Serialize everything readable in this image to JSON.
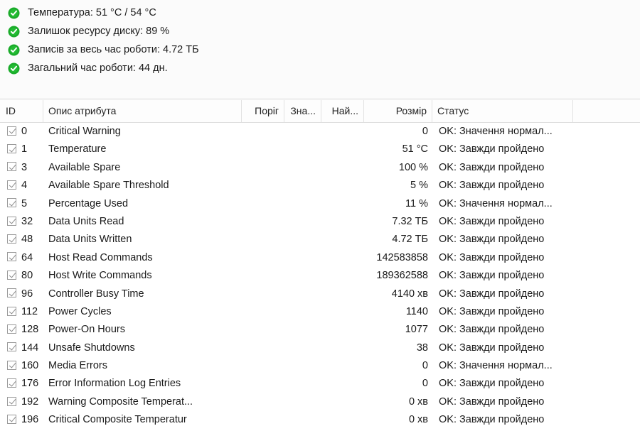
{
  "summary": {
    "icon": "green-check-circle-icon",
    "icon_color": "#1aab2a",
    "items": [
      {
        "label": "Температура: 51 °C / 54 °C"
      },
      {
        "label": "Залишок ресурсу диску: 89 %"
      },
      {
        "label": "Записів за весь час роботи: 4.72 ТБ"
      },
      {
        "label": "Загальний час роботи: 44 дн."
      }
    ]
  },
  "table": {
    "columns": [
      {
        "key": "id",
        "label": "ID"
      },
      {
        "key": "desc",
        "label": "Опис атрибута"
      },
      {
        "key": "threshold",
        "label": "Поріг"
      },
      {
        "key": "value",
        "label": "Зна..."
      },
      {
        "key": "worst",
        "label": "Най..."
      },
      {
        "key": "size",
        "label": "Розмір"
      },
      {
        "key": "status",
        "label": "Статус"
      },
      {
        "key": "spare",
        "label": ""
      }
    ],
    "rows": [
      {
        "checked": true,
        "id": "0",
        "desc": "Critical Warning",
        "threshold": "",
        "value": "",
        "worst": "",
        "size": "0",
        "status": "OK: Значення нормал..."
      },
      {
        "checked": true,
        "id": "1",
        "desc": "Temperature",
        "threshold": "",
        "value": "",
        "worst": "",
        "size": "51 °C",
        "status": "OK: Завжди пройдено"
      },
      {
        "checked": true,
        "id": "3",
        "desc": "Available Spare",
        "threshold": "",
        "value": "",
        "worst": "",
        "size": "100 %",
        "status": "OK: Завжди пройдено"
      },
      {
        "checked": true,
        "id": "4",
        "desc": "Available Spare Threshold",
        "threshold": "",
        "value": "",
        "worst": "",
        "size": "5 %",
        "status": "OK: Завжди пройдено"
      },
      {
        "checked": true,
        "id": "5",
        "desc": "Percentage Used",
        "threshold": "",
        "value": "",
        "worst": "",
        "size": "11 %",
        "status": "OK: Значення нормал..."
      },
      {
        "checked": true,
        "id": "32",
        "desc": "Data Units Read",
        "threshold": "",
        "value": "",
        "worst": "",
        "size": "7.32 ТБ",
        "status": "OK: Завжди пройдено"
      },
      {
        "checked": true,
        "id": "48",
        "desc": "Data Units Written",
        "threshold": "",
        "value": "",
        "worst": "",
        "size": "4.72 ТБ",
        "status": "OK: Завжди пройдено"
      },
      {
        "checked": true,
        "id": "64",
        "desc": "Host Read Commands",
        "threshold": "",
        "value": "",
        "worst": "",
        "size": "142583858",
        "status": "OK: Завжди пройдено"
      },
      {
        "checked": true,
        "id": "80",
        "desc": "Host Write Commands",
        "threshold": "",
        "value": "",
        "worst": "",
        "size": "189362588",
        "status": "OK: Завжди пройдено"
      },
      {
        "checked": true,
        "id": "96",
        "desc": "Controller Busy Time",
        "threshold": "",
        "value": "",
        "worst": "",
        "size": "4140 хв",
        "status": "OK: Завжди пройдено"
      },
      {
        "checked": true,
        "id": "112",
        "desc": "Power Cycles",
        "threshold": "",
        "value": "",
        "worst": "",
        "size": "1140",
        "status": "OK: Завжди пройдено"
      },
      {
        "checked": true,
        "id": "128",
        "desc": "Power-On Hours",
        "threshold": "",
        "value": "",
        "worst": "",
        "size": "1077",
        "status": "OK: Завжди пройдено"
      },
      {
        "checked": true,
        "id": "144",
        "desc": "Unsafe Shutdowns",
        "threshold": "",
        "value": "",
        "worst": "",
        "size": "38",
        "status": "OK: Завжди пройдено"
      },
      {
        "checked": true,
        "id": "160",
        "desc": "Media Errors",
        "threshold": "",
        "value": "",
        "worst": "",
        "size": "0",
        "status": "OK: Значення нормал..."
      },
      {
        "checked": true,
        "id": "176",
        "desc": "Error Information Log Entries",
        "threshold": "",
        "value": "",
        "worst": "",
        "size": "0",
        "status": "OK: Завжди пройдено"
      },
      {
        "checked": true,
        "id": "192",
        "desc": "Warning Composite Temperat...",
        "threshold": "",
        "value": "",
        "worst": "",
        "size": "0 хв",
        "status": "OK: Завжди пройдено"
      },
      {
        "checked": true,
        "id": "196",
        "desc": "Critical Composite Temperatur",
        "threshold": "",
        "value": "",
        "worst": "",
        "size": "0 хв",
        "status": "OK: Завжди пройдено"
      }
    ]
  }
}
